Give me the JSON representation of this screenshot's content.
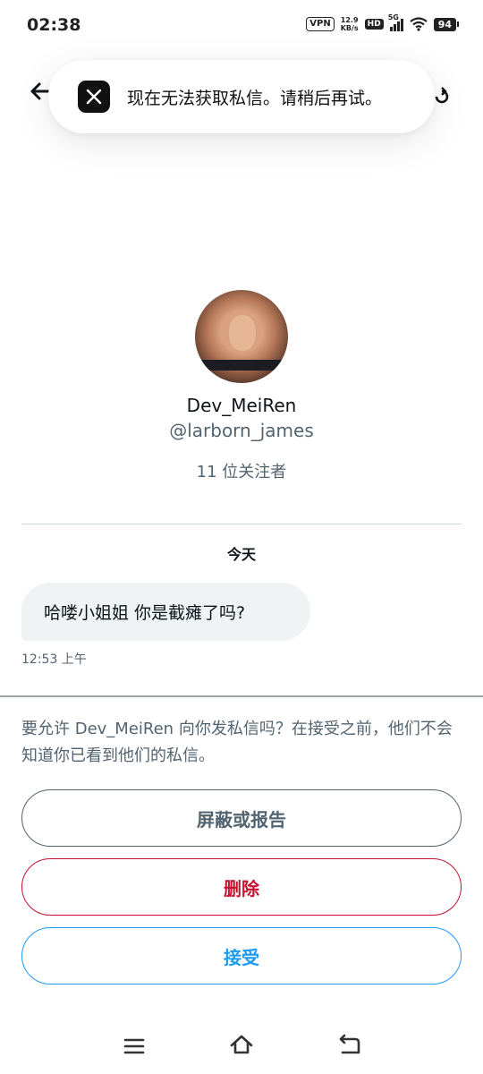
{
  "status_bar": {
    "time": "02:38",
    "vpn": "VPN",
    "net_speed_value": "12.9",
    "net_speed_unit": "KB/s",
    "hd": "HD",
    "network": "5G",
    "battery": "94"
  },
  "toast": {
    "icon": "x-logo-icon",
    "message": "现在无法获取私信。请稍后再试。"
  },
  "profile": {
    "display_name": "Dev_MeiRen",
    "handle": "@larborn_james",
    "followers": "11 位关注者"
  },
  "conversation": {
    "date_label": "今天",
    "messages": [
      {
        "text": "哈喽小姐姐 你是截瘫了吗?",
        "time": "12:53 上午"
      }
    ]
  },
  "request": {
    "prompt": "要允许 Dev_MeiRen 向你发私信吗？在接受之前，他们不会知道你已看到他们的私信。",
    "block_report_label": "屏蔽或报告",
    "delete_label": "删除",
    "accept_label": "接受"
  },
  "colors": {
    "accent": "#1d9bf0",
    "danger": "#c4122f",
    "secondary_text": "#536471",
    "bubble": "#eff3f4"
  }
}
